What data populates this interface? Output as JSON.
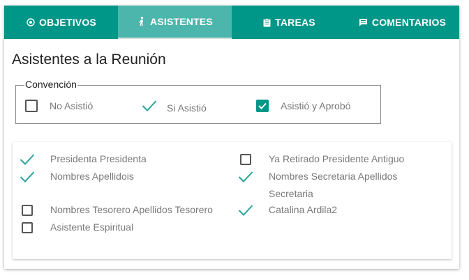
{
  "tabs": [
    {
      "label": "OBJETIVOS",
      "icon": "target-icon",
      "active": false
    },
    {
      "label": "ASISTENTES",
      "icon": "walking-person-icon",
      "active": true
    },
    {
      "label": "TAREAS",
      "icon": "clipboard-icon",
      "active": false
    },
    {
      "label": "COMENTARIOS",
      "icon": "comment-icon",
      "active": false
    }
  ],
  "page_title": "Asistentes a la Reunión",
  "legend": {
    "title": "Convención",
    "items": [
      {
        "label": "No Asistió",
        "state": "unchecked"
      },
      {
        "label": "Si Asistió",
        "state": "checkmark"
      },
      {
        "label": "Asistió y Aprobó",
        "state": "checked-box"
      }
    ]
  },
  "attendees": [
    {
      "name": "Presidenta Presidenta",
      "state": "checkmark"
    },
    {
      "name": "Nombres Apellidois",
      "state": "checkmark"
    },
    {
      "name": "Nombres Tesorero Apellidos Tesorero",
      "state": "unchecked"
    },
    {
      "name": "Asistente Espiritual",
      "state": "unchecked"
    },
    {
      "name": "Ya Retirado Presidente Antiguo",
      "state": "unchecked"
    },
    {
      "name": "Nombres Secretaria Apellidos",
      "name_line2": "Secretaria",
      "state": "checkmark"
    },
    {
      "name": "Catalina Ardila2",
      "state": "checkmark"
    }
  ],
  "colors": {
    "accent": "#009688",
    "accent_light": "#4db6ac",
    "check": "#26a69a"
  }
}
